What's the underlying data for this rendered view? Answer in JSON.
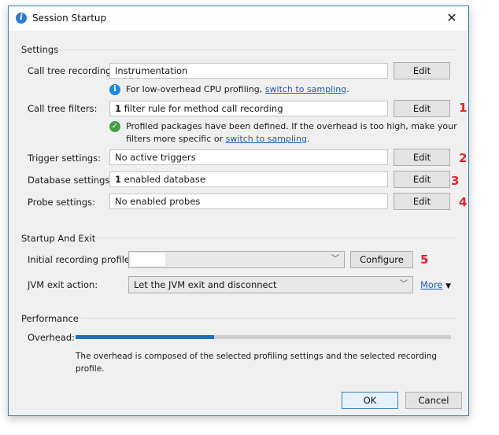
{
  "window": {
    "title": "Session Startup",
    "close": "✕"
  },
  "settings": {
    "section": "Settings",
    "call_tree_recording": {
      "label": "Call tree recording:",
      "value": "Instrumentation",
      "button": "Edit"
    },
    "recording_info": {
      "text": "For low-overhead CPU profiling, ",
      "link": "switch to sampling",
      "after": "."
    },
    "call_tree_filters": {
      "label": "Call tree filters:",
      "value_bold": "1",
      "value": " filter rule for method call recording",
      "button": "Edit",
      "marker": "1"
    },
    "filters_info": {
      "line1": "Profiled packages have been defined. If the overhead is too high, make your",
      "line2_prefix": "filters more specific or ",
      "link": "switch to sampling",
      "after": "."
    },
    "trigger_settings": {
      "label": "Trigger settings:",
      "value": "No active triggers",
      "button": "Edit",
      "marker": "2"
    },
    "database_settings": {
      "label": "Database settings:",
      "value_bold": "1",
      "value": " enabled database",
      "button": "Edit",
      "marker": "3"
    },
    "probe_settings": {
      "label": "Probe settings:",
      "value": "No enabled probes",
      "button": "Edit",
      "marker": "4"
    }
  },
  "startup": {
    "section": "Startup And Exit",
    "initial_profile": {
      "label": "Initial recording profile:",
      "value": "",
      "button": "Configure",
      "marker": "5"
    },
    "jvm_exit": {
      "label": "JVM exit action:",
      "value": "Let the JVM exit and disconnect",
      "more": "More"
    }
  },
  "performance": {
    "section": "Performance",
    "overhead_label": "Overhead:",
    "overhead_fraction": 0.37,
    "description_line1": "The overhead is composed of the selected profiling settings and the selected recording",
    "description_line2": "profile."
  },
  "footer": {
    "ok": "OK",
    "cancel": "Cancel"
  },
  "colors": {
    "accent": "#1c6fbf",
    "marker": "#e0262b",
    "link": "#1a5fb4"
  }
}
